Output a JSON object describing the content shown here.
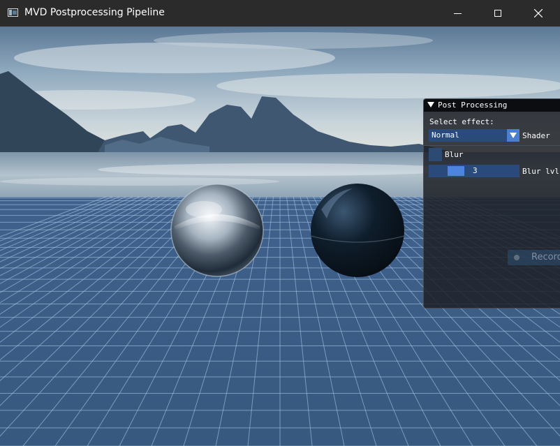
{
  "window": {
    "title": "MVD Postprocessing Pipeline",
    "icons": {
      "app": "app-window-icon",
      "minimize": "minimize-icon",
      "maximize": "maximize-icon",
      "close": "close-icon"
    }
  },
  "scene": {
    "colors": {
      "titlebar": "#2b2b2b",
      "sky": "#b9c9d4",
      "water": "#9fb2c2",
      "grid_floor": "#3c5f8a",
      "grid_lines": "#a9c4e2"
    },
    "objects": [
      "chrome-sphere",
      "dark-blue-sphere",
      "mountains",
      "grid-floor"
    ]
  },
  "post_processing": {
    "title": "Post Processing",
    "select_effect_label": "Select effect:",
    "effect_value": "Normal",
    "combo_label": "Shader",
    "blur_label": "Blur",
    "blur_checked": false,
    "blur_level": "3",
    "blur_level_label": "Blur lvl",
    "record_label": "Record",
    "colors": {
      "frame": "#1e2126",
      "widget": "#294a7a",
      "accent": "#4c7ed0"
    }
  }
}
